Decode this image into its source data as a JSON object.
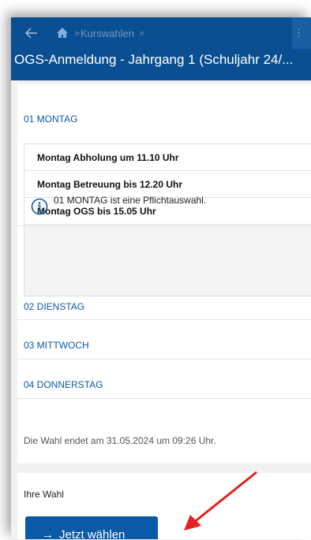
{
  "header": {
    "breadcrumb": "Kurswahlen",
    "separator": "»",
    "menu_dots": "⋮",
    "title": "OGS-Anmeldung - Jahrgang 1 (Schuljahr 24/..."
  },
  "days": {
    "monday": "01 MONTAG",
    "monday_options": [
      "Montag Abholung um 11.10 Uhr",
      "Montag Betreuung bis 12.20 Uhr",
      "Montag OGS bis 15.05 Uhr"
    ],
    "info": "01 MONTAG ist eine Pflichtauswahl.",
    "tuesday": "02 DIENSTAG",
    "wednesday": "03 MITTWOCH",
    "thursday": "04 DONNERSTAG"
  },
  "deadline": "Die Wahl endet am 31.05.2024 um 09:26 Uhr.",
  "footer": {
    "choice_label": "Ihre Wahl",
    "button_label": "Jetzt wählen",
    "button_arrow": "→"
  },
  "colors": {
    "header_bg": "#0a4f91",
    "accent": "#0a5aa8",
    "annotation": "#e3211f"
  },
  "icons": [
    "back-arrow-icon",
    "home-icon",
    "info-icon",
    "arrow-right-icon",
    "annotation-arrow"
  ]
}
